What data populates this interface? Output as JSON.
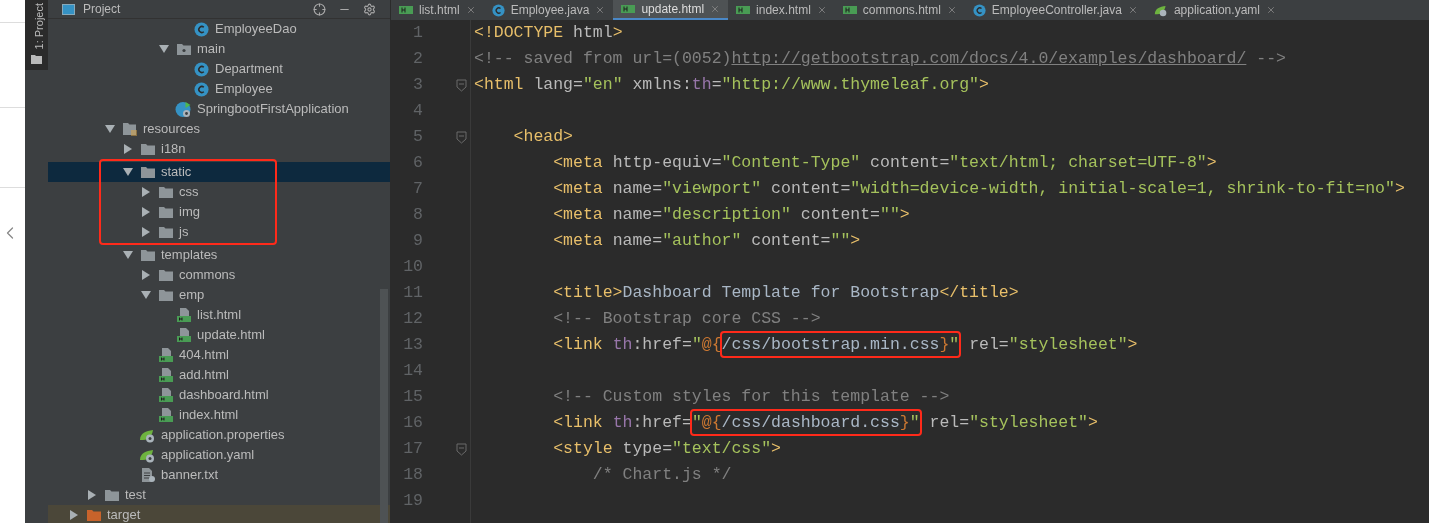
{
  "tool_strip": {
    "label": "1: Project"
  },
  "project_panel": {
    "title": "Project"
  },
  "tree": [
    {
      "children": [
        {
          "children": [
            {
              "children": [
                {
                  "children": [
                    {
                      "children": [
                        {
                          "children": [
                            {
                              "name": "EmployeeDao",
                              "kind": "class",
                              "selected": false
                            }
                          ]
                        },
                        {
                          "name": "main",
                          "kind": "package",
                          "expanded": true,
                          "selected": false,
                          "children": [
                            {
                              "name": "Department",
                              "kind": "class",
                              "selected": false
                            },
                            {
                              "name": "Employee",
                              "kind": "class",
                              "selected": false
                            }
                          ]
                        },
                        {
                          "name": "SpringbootFirstApplication",
                          "kind": "spring_app",
                          "selected": false
                        }
                      ]
                    }
                  ]
                }
              ]
            },
            {
              "name": "resources",
              "kind": "resources_folder",
              "expanded": true,
              "selected": false,
              "children": [
                {
                  "name": "i18n",
                  "kind": "folder",
                  "expanded": false,
                  "selected": false
                },
                {
                  "name": "static",
                  "kind": "folder",
                  "expanded": true,
                  "selected": true,
                  "boxed": true,
                  "children": [
                    {
                      "name": "css",
                      "kind": "folder",
                      "expanded": false,
                      "selected": false
                    },
                    {
                      "name": "img",
                      "kind": "folder",
                      "expanded": false,
                      "selected": false
                    },
                    {
                      "name": "js",
                      "kind": "folder",
                      "expanded": false,
                      "selected": false
                    }
                  ]
                },
                {
                  "name": "templates",
                  "kind": "folder",
                  "expanded": true,
                  "selected": false,
                  "children": [
                    {
                      "name": "commons",
                      "kind": "folder",
                      "expanded": false,
                      "selected": false
                    },
                    {
                      "name": "emp",
                      "kind": "folder",
                      "expanded": true,
                      "selected": false,
                      "children": [
                        {
                          "name": "list.html",
                          "kind": "html",
                          "selected": false
                        },
                        {
                          "name": "update.html",
                          "kind": "html",
                          "selected": false
                        }
                      ]
                    },
                    {
                      "name": "404.html",
                      "kind": "html",
                      "selected": false
                    },
                    {
                      "name": "add.html",
                      "kind": "html",
                      "selected": false
                    },
                    {
                      "name": "dashboard.html",
                      "kind": "html",
                      "selected": false
                    },
                    {
                      "name": "index.html",
                      "kind": "html",
                      "selected": false
                    }
                  ]
                },
                {
                  "name": "application.properties",
                  "kind": "spring_config",
                  "selected": false
                },
                {
                  "name": "application.yaml",
                  "kind": "spring_config",
                  "selected": false
                },
                {
                  "name": "banner.txt",
                  "kind": "text",
                  "selected": false
                }
              ]
            }
          ]
        },
        {
          "name": "test",
          "kind": "folder",
          "expanded": false,
          "selected": false
        }
      ]
    },
    {
      "name": "target",
      "kind": "excluded_folder",
      "expanded": false,
      "selected": false
    }
  ],
  "tabs": [
    {
      "label": "list.html",
      "kind": "html",
      "selected": false
    },
    {
      "label": "Employee.java",
      "kind": "class",
      "selected": false
    },
    {
      "label": "update.html",
      "kind": "html",
      "selected": true
    },
    {
      "label": "index.html",
      "kind": "html",
      "selected": false
    },
    {
      "label": "commons.html",
      "kind": "html",
      "selected": false
    },
    {
      "label": "EmployeeController.java",
      "kind": "class",
      "selected": false
    },
    {
      "label": "application.yaml",
      "kind": "spring_config",
      "selected": false
    }
  ],
  "lines": [
    {
      "number": "1",
      "fold": false,
      "tokens": [
        {
          "kind": "tag",
          "text": "<!DOCTYPE"
        },
        {
          "kind": "attr",
          "text": " html"
        },
        {
          "kind": "tag",
          "text": ">"
        }
      ]
    },
    {
      "number": "2",
      "fold": false,
      "tokens": [
        {
          "kind": "comment",
          "text": "<!-- saved from url=(0052)"
        },
        {
          "kind": "link",
          "text": "http://getbootstrap.com/docs/4.0/examples/dashboard/"
        },
        {
          "kind": "comment",
          "text": " -->"
        }
      ]
    },
    {
      "number": "3",
      "fold": true,
      "tokens": [
        {
          "kind": "tag",
          "text": "<html"
        },
        {
          "kind": "attr",
          "text": " lang="
        },
        {
          "kind": "value",
          "text": "\"en\""
        },
        {
          "kind": "attr",
          "text": " xmlns:"
        },
        {
          "kind": "ns",
          "text": "th"
        },
        {
          "kind": "attr",
          "text": "="
        },
        {
          "kind": "value",
          "text": "\"http://www.thymeleaf.org\""
        },
        {
          "kind": "tag",
          "text": ">"
        }
      ]
    },
    {
      "number": "4",
      "fold": false
    },
    {
      "number": "5",
      "fold": true,
      "tokens": [
        {
          "kind": "tag",
          "text": "    <head>"
        }
      ]
    },
    {
      "number": "6",
      "fold": false,
      "tokens": [
        {
          "kind": "tag",
          "text": "        <meta"
        },
        {
          "kind": "attr",
          "text": " http-equiv="
        },
        {
          "kind": "value",
          "text": "\"Content-Type\""
        },
        {
          "kind": "attr",
          "text": " content="
        },
        {
          "kind": "value",
          "text": "\"text/html; charset=UTF-8\""
        },
        {
          "kind": "tag",
          "text": ">"
        }
      ]
    },
    {
      "number": "7",
      "fold": false,
      "tokens": [
        {
          "kind": "tag",
          "text": "        <meta"
        },
        {
          "kind": "attr",
          "text": " name="
        },
        {
          "kind": "value",
          "text": "\"viewport\""
        },
        {
          "kind": "attr",
          "text": " content="
        },
        {
          "kind": "value",
          "text": "\"width=device-width, initial-scale=1, shrink-to-fit=no\""
        },
        {
          "kind": "tag",
          "text": ">"
        }
      ]
    },
    {
      "number": "8",
      "fold": false,
      "tokens": [
        {
          "kind": "tag",
          "text": "        <meta"
        },
        {
          "kind": "attr",
          "text": " name="
        },
        {
          "kind": "value",
          "text": "\"description\""
        },
        {
          "kind": "attr",
          "text": " content="
        },
        {
          "kind": "value",
          "text": "\"\""
        },
        {
          "kind": "tag",
          "text": ">"
        }
      ]
    },
    {
      "number": "9",
      "fold": false,
      "tokens": [
        {
          "kind": "tag",
          "text": "        <meta"
        },
        {
          "kind": "attr",
          "text": " name="
        },
        {
          "kind": "value",
          "text": "\"author\""
        },
        {
          "kind": "attr",
          "text": " content="
        },
        {
          "kind": "value",
          "text": "\"\""
        },
        {
          "kind": "tag",
          "text": ">"
        }
      ]
    },
    {
      "number": "10",
      "fold": false
    },
    {
      "number": "11",
      "fold": false,
      "tokens": [
        {
          "kind": "tag",
          "text": "        <title>"
        },
        {
          "kind": "text",
          "text": "Dashboard Template for Bootstrap"
        },
        {
          "kind": "tag",
          "text": "</title>"
        }
      ]
    },
    {
      "number": "12",
      "fold": false,
      "tokens": [
        {
          "kind": "comment",
          "text": "        <!-- Bootstrap core CSS -->"
        }
      ]
    },
    {
      "number": "13",
      "fold": false,
      "tokens": [
        {
          "kind": "tag",
          "text": "        <link"
        },
        {
          "kind": "ns",
          "text": " th"
        },
        {
          "kind": "attr",
          "text": ":href="
        },
        {
          "kind": "value",
          "text": "\""
        },
        {
          "kind": "expr",
          "text": "@{"
        },
        {
          "kind": "group",
          "boxed": true,
          "tokens": [
            {
              "kind": "path",
              "text": "/css/bootstrap.min.css"
            },
            {
              "kind": "expr",
              "text": "}"
            },
            {
              "kind": "value",
              "text": "\""
            }
          ]
        },
        {
          "kind": "attr",
          "text": " rel="
        },
        {
          "kind": "value",
          "text": "\"stylesheet\""
        },
        {
          "kind": "tag",
          "text": ">"
        }
      ]
    },
    {
      "number": "14",
      "fold": false
    },
    {
      "number": "15",
      "fold": false,
      "tokens": [
        {
          "kind": "comment",
          "text": "        <!-- Custom styles for this template -->"
        }
      ]
    },
    {
      "number": "16",
      "fold": false,
      "tokens": [
        {
          "kind": "tag",
          "text": "        <link"
        },
        {
          "kind": "ns",
          "text": " th"
        },
        {
          "kind": "attr",
          "text": ":href="
        },
        {
          "kind": "group",
          "boxed": true,
          "tokens": [
            {
              "kind": "value",
              "text": "\""
            },
            {
              "kind": "expr",
              "text": "@{"
            },
            {
              "kind": "path",
              "text": "/css/dashboard.css"
            },
            {
              "kind": "expr",
              "text": "}"
            },
            {
              "kind": "value",
              "text": "\""
            }
          ]
        },
        {
          "kind": "attr",
          "text": " rel="
        },
        {
          "kind": "value",
          "text": "\"stylesheet\""
        },
        {
          "kind": "tag",
          "text": ">"
        }
      ]
    },
    {
      "number": "17",
      "fold": true,
      "tokens": [
        {
          "kind": "tag",
          "text": "        <style"
        },
        {
          "kind": "attr",
          "text": " type="
        },
        {
          "kind": "value",
          "text": "\"text/css\""
        },
        {
          "kind": "tag",
          "text": ">"
        }
      ]
    },
    {
      "number": "18",
      "fold": false,
      "tokens": [
        {
          "kind": "comment",
          "text": "            /* Chart.js */"
        }
      ]
    },
    {
      "number": "19",
      "fold": false
    }
  ]
}
